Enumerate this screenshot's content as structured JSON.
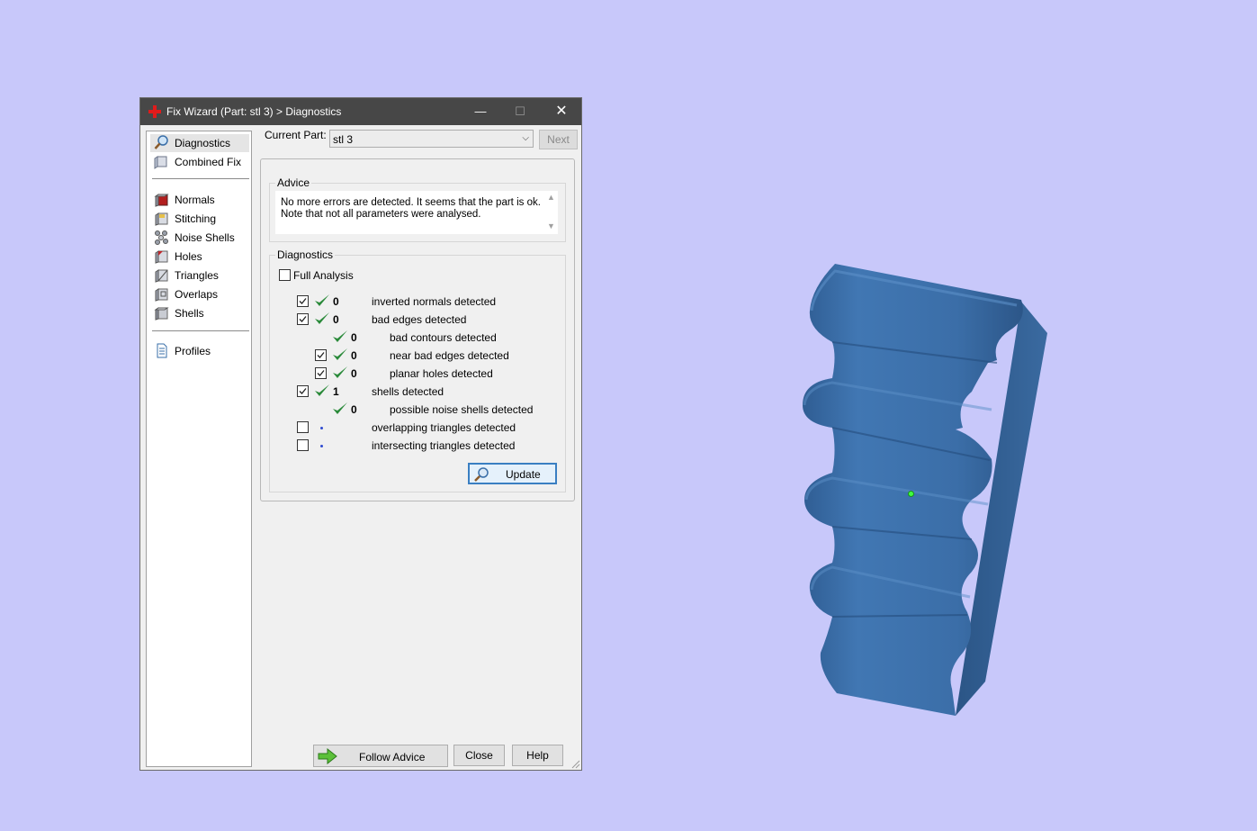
{
  "window": {
    "title": "Fix Wizard (Part: stl 3) > Diagnostics",
    "minimize_symbol": "—",
    "maximize_symbol": "☐",
    "close_symbol": "✕"
  },
  "sidebar": {
    "items": [
      {
        "label": "Diagnostics",
        "icon": "magnifier-icon",
        "selected": true
      },
      {
        "label": "Combined Fix",
        "icon": "cube-icon"
      },
      {
        "label": "Normals",
        "icon": "normals-cube-icon"
      },
      {
        "label": "Stitching",
        "icon": "stitching-cube-icon"
      },
      {
        "label": "Noise Shells",
        "icon": "noise-shells-icon"
      },
      {
        "label": "Holes",
        "icon": "holes-cube-icon"
      },
      {
        "label": "Triangles",
        "icon": "triangles-cube-icon"
      },
      {
        "label": "Overlaps",
        "icon": "overlaps-cube-icon"
      },
      {
        "label": "Shells",
        "icon": "shells-cube-icon"
      },
      {
        "label": "Profiles",
        "icon": "document-icon"
      }
    ]
  },
  "main": {
    "current_part_label": "Current Part:",
    "current_part_value": "stl 3",
    "next_label": "Next",
    "advice": {
      "title": "Advice",
      "line1": "No more errors are detected. It seems that the part is ok.",
      "line2": "Note that not all parameters were analysed."
    },
    "diagnostics": {
      "title": "Diagnostics",
      "full_analysis_label": "Full Analysis",
      "rows": [
        {
          "checkbox": true,
          "checked": true,
          "status": "ok",
          "value": "0",
          "label": "inverted normals detected",
          "indent": 0
        },
        {
          "checkbox": true,
          "checked": true,
          "status": "ok",
          "value": "0",
          "label": "bad edges detected",
          "indent": 0
        },
        {
          "checkbox": false,
          "checked": false,
          "status": "ok",
          "value": "0",
          "label": "bad contours detected",
          "indent": 1
        },
        {
          "checkbox": true,
          "checked": true,
          "status": "ok",
          "value": "0",
          "label": "near bad edges detected",
          "indent": 1
        },
        {
          "checkbox": true,
          "checked": true,
          "status": "ok",
          "value": "0",
          "label": "planar holes detected",
          "indent": 1
        },
        {
          "checkbox": true,
          "checked": true,
          "status": "ok",
          "value": "1",
          "label": "shells detected",
          "indent": 0
        },
        {
          "checkbox": false,
          "checked": false,
          "status": "ok",
          "value": "0",
          "label": "possible noise shells detected",
          "indent": 1
        },
        {
          "checkbox": true,
          "checked": false,
          "status": "none",
          "value": "",
          "label": "overlapping triangles detected",
          "indent": 0
        },
        {
          "checkbox": true,
          "checked": false,
          "status": "none",
          "value": "",
          "label": "intersecting triangles detected",
          "indent": 0
        }
      ],
      "update_label": "Update"
    },
    "footer": {
      "follow_advice_label": "Follow Advice",
      "close_label": "Close",
      "help_label": "Help"
    }
  },
  "colors": {
    "desktop": "#c8c8fa",
    "titlebar": "#474747",
    "check_green": "#2a8a3a",
    "model_blue": "#3d6fa6"
  }
}
